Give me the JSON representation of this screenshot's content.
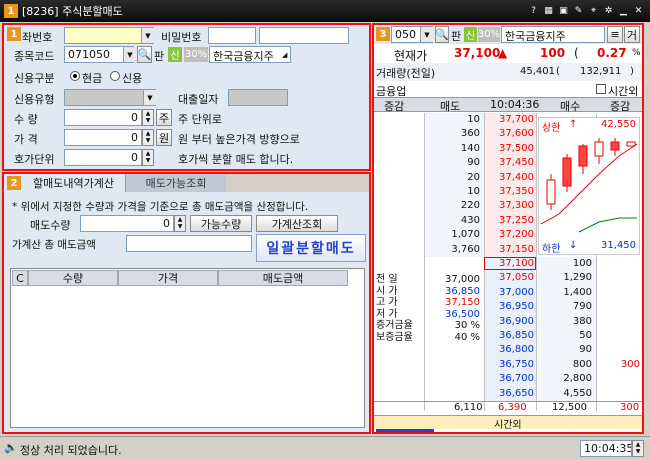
{
  "window": {
    "number": "1",
    "title": "[8236] 주식분할매도",
    "icons": [
      "help-icon",
      "calc-icon",
      "pin-icon",
      "tree-icon",
      "gear-icon",
      "minimize-icon",
      "close-icon"
    ]
  },
  "order_panel": {
    "badge": "1",
    "account_label": "좌번호",
    "account_value": "",
    "password_label": "비밀번호",
    "password_value": "",
    "code_label": "종목코드",
    "code_value": "071050",
    "pan_label": "판",
    "shin_tag": "신",
    "margin_tag": "30%",
    "stock_name": "한국금융지주",
    "credit_type_label": "신용구분",
    "credit_opt_cash": "현금",
    "credit_opt_credit": "신용",
    "credit_kind_label": "신용유형",
    "loan_date_label": "대출일자",
    "qty_label": "수      량",
    "qty_value": "0",
    "qty_unit_btn": "주",
    "qty_suffix": "주 단위로",
    "price_label": "가      격",
    "price_value": "0",
    "price_unit_btn": "원",
    "price_suffix": "원 부터 높은가격 방향으로",
    "tick_label": "호가단위",
    "tick_value": "0",
    "tick_suffix": "호가씩 분할 매도 합니다."
  },
  "calc_panel": {
    "badge": "2",
    "tab1": "할매도내역가계산",
    "tab2": "매도가능조회",
    "note": "* 위에서 지정한 수량과 가격을 기준으로 총 매도금액을 산정합니다.",
    "sell_qty_label": "매도수량",
    "sell_qty_value": "0",
    "avail_qty_btn": "가능수량",
    "calc_btn": "가계산조회",
    "total_label": "가계산 총 매도금액",
    "total_value": "",
    "bulk_sell_btn": "일괄분할매도",
    "grid_headers": [
      "C",
      "수량",
      "가격",
      "매도금액"
    ]
  },
  "quote_panel": {
    "badge": "3",
    "code": "050",
    "pan_label": "판",
    "shin_tag": "신",
    "margin_tag": "30%",
    "stock_name": "한국금융지주",
    "cur_price_label": "현재가",
    "cur_price": "37,100",
    "change": "100",
    "change_pct": "0.27",
    "pct_sign": "%",
    "volume_label": "거래량(전일)",
    "volume": "45,401",
    "prev_volume": "132,911",
    "sector": "금융업",
    "after_hours_label": "시간외",
    "headers": [
      "증감",
      "매도",
      "10:04:36",
      "매수",
      "증감"
    ],
    "ask_rows": [
      {
        "qty": "10",
        "price": "37,700"
      },
      {
        "qty": "360",
        "price": "37,600"
      },
      {
        "qty": "140",
        "price": "37,500"
      },
      {
        "qty": "90",
        "price": "37,450"
      },
      {
        "qty": "20",
        "price": "37,400"
      },
      {
        "qty": "10",
        "price": "37,350"
      },
      {
        "qty": "220",
        "price": "37,300"
      },
      {
        "qty": "430",
        "price": "37,250"
      },
      {
        "qty": "1,070",
        "price": "37,200"
      },
      {
        "qty": "3,760",
        "price": "37,150"
      }
    ],
    "bid_rows": [
      {
        "price": "37,100",
        "qty": "100",
        "chg": ""
      },
      {
        "price": "37,050",
        "qty": "1,290",
        "chg": ""
      },
      {
        "price": "37,000",
        "qty": "1,400",
        "chg": ""
      },
      {
        "price": "36,950",
        "qty": "790",
        "chg": ""
      },
      {
        "price": "36,900",
        "qty": "380",
        "chg": ""
      },
      {
        "price": "36,850",
        "qty": "50",
        "chg": ""
      },
      {
        "price": "36,800",
        "qty": "90",
        "chg": ""
      },
      {
        "price": "36,750",
        "qty": "800",
        "chg": "300"
      },
      {
        "price": "36,700",
        "qty": "2,800",
        "chg": ""
      },
      {
        "price": "36,650",
        "qty": "4,550",
        "chg": ""
      }
    ],
    "info": [
      {
        "label": "전   일",
        "value": "37,000",
        "color": "#111111"
      },
      {
        "label": "시   가",
        "value": "36,850",
        "color": "#0033cc"
      },
      {
        "label": "고   가",
        "value": "37,150",
        "color": "#e00000"
      },
      {
        "label": "저   가",
        "value": "36,500",
        "color": "#0033cc"
      },
      {
        "label": "증거금율",
        "value": "30 %",
        "color": "#111111"
      },
      {
        "label": "보증금율",
        "value": "40 %",
        "color": "#111111"
      }
    ],
    "upper_label": "상한",
    "upper_price": "42,550",
    "lower_label": "하한",
    "lower_price": "31,450",
    "total_ask": "6,110",
    "total_mid": "6,390",
    "total_bid": "12,500",
    "total_chg": "300",
    "after_hours_footer": "시간외"
  },
  "status": {
    "message": "정상 처리 되었습니다.",
    "time": "10:04:35"
  }
}
